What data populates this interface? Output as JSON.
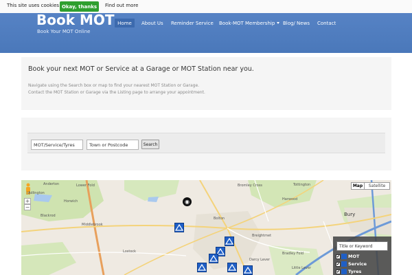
{
  "cookie": {
    "text": "This site uses cookies",
    "ok_label": "Okay, thanks",
    "more_label": "Find out more"
  },
  "header": {
    "title": "Book MOT",
    "tagline": "Book Your MOT Online"
  },
  "nav": {
    "home": "Home",
    "about": "About Us",
    "reminder": "Reminder Service",
    "membership": "Book-MOT Membership",
    "blog": "Blog/ News",
    "contact": "Contact"
  },
  "intro": {
    "heading": "Book your next MOT or Service at a Garage or MOT Station near you.",
    "line1": "Navigate using the Search box or map to find your nearest MOT Station or Garage.",
    "line2": "Contact the MOT Station or Garage via the Listing page to arrange your appointment."
  },
  "search": {
    "service_value": "MOT/Service/Tyres",
    "town_value": "Town or Postcode",
    "button": "Search"
  },
  "map": {
    "type_map": "Map",
    "type_satellite": "Satellite",
    "zoom_in": "+",
    "zoom_out": "−",
    "places": {
      "anderton": "Anderton",
      "lower_fold": "Lower Fold",
      "adlington": "Adlington",
      "horwich": "Horwich",
      "blackrod": "Blackrod",
      "middlebrook": "Middlebrook",
      "lostock": "Lostock",
      "bolton": "Bolton",
      "breightmet": "Breightmet",
      "harwood": "Harwood",
      "tottington": "Tottington",
      "bury": "Bury",
      "little_lever": "Little Lever",
      "bradley_fold": "Bradley Fold",
      "darcy_lever": "Darcy Lever",
      "bromley_cross": "Bromley Cross"
    },
    "legend": {
      "search_placeholder": "Title or Keyword",
      "items": [
        "MOT",
        "Service",
        "Tyres"
      ]
    }
  }
}
